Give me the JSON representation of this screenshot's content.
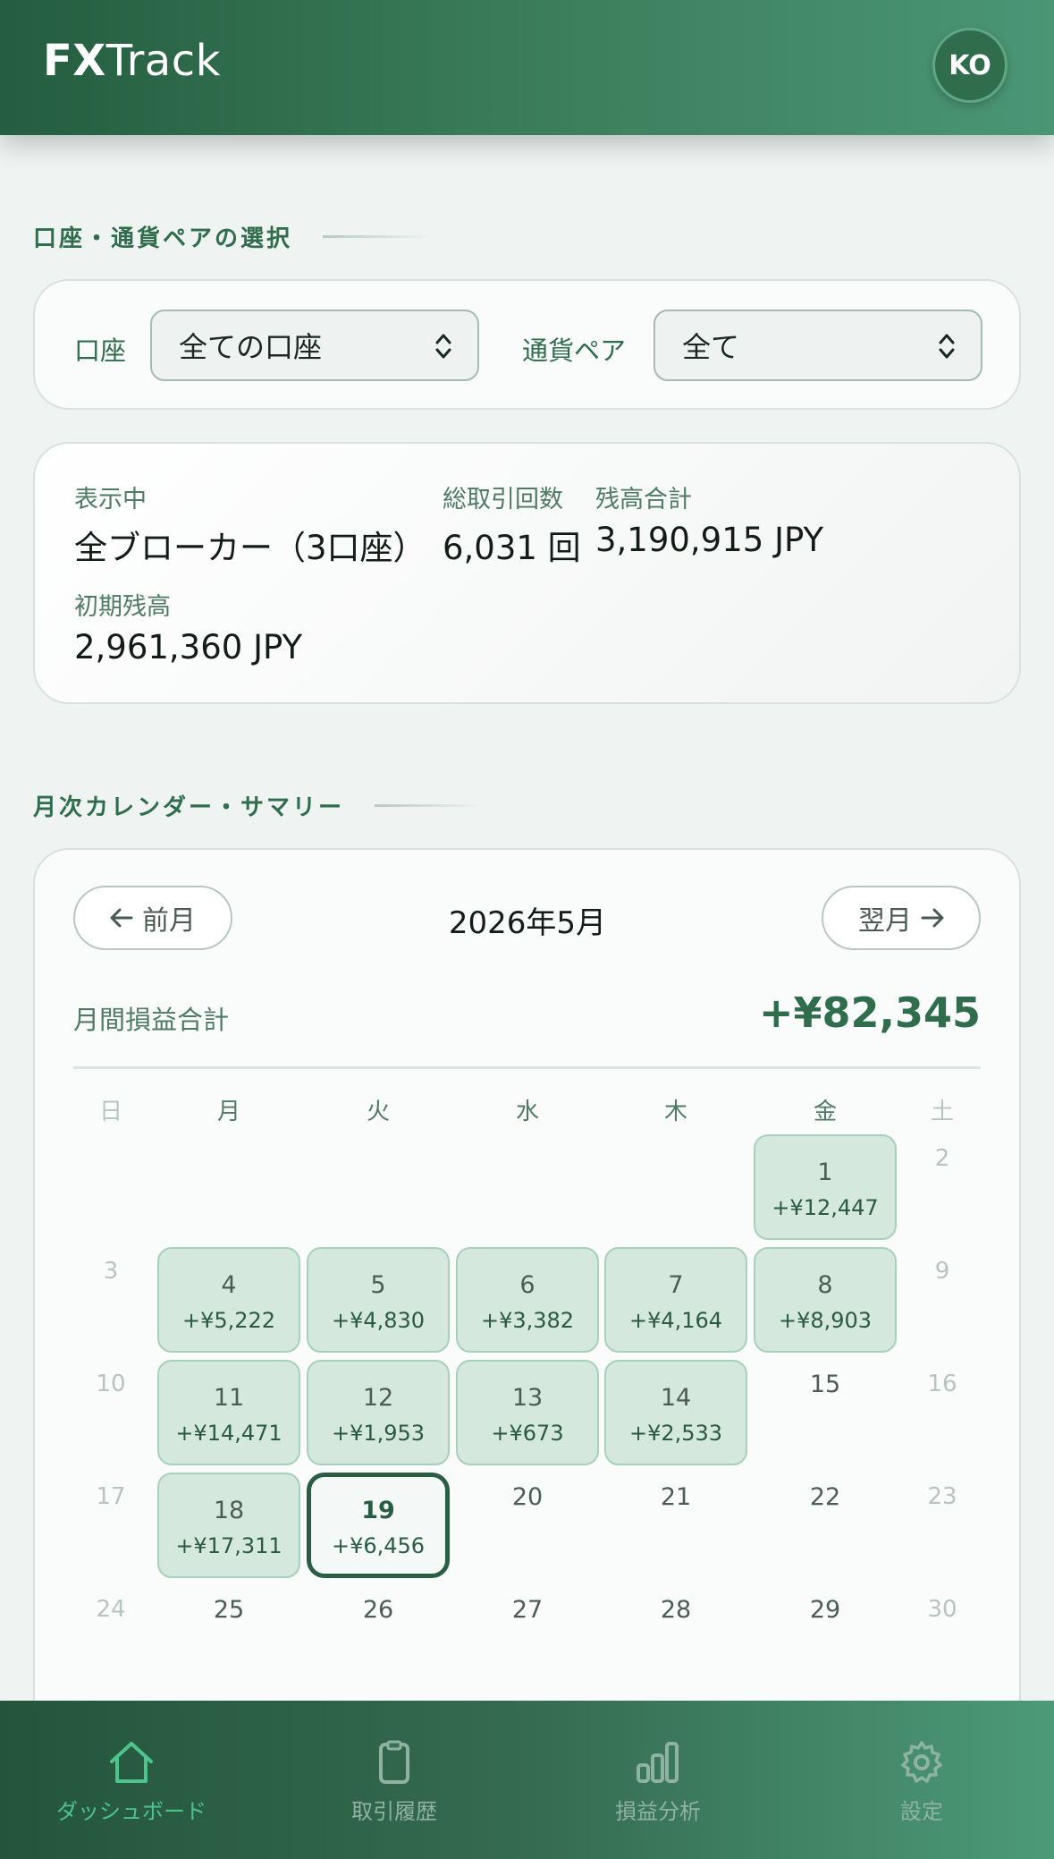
{
  "header": {
    "brand_bold": "FX",
    "brand_rest": "Track",
    "avatar": "KO"
  },
  "selection": {
    "title": "口座・通貨ペアの選択",
    "account_label": "口座",
    "account_value": "全ての口座",
    "pair_label": "通貨ペア",
    "pair_value": "全て"
  },
  "summary": {
    "showing_label": "表示中",
    "showing_value": "全ブローカー（3口座）",
    "trades_label": "総取引回数",
    "trades_value": "6,031 回",
    "balance_label": "残高合計",
    "balance_value": "3,190,915 JPY",
    "initial_label": "初期残高",
    "initial_value": "2,961,360 JPY"
  },
  "calendar": {
    "title": "月次カレンダー・サマリー",
    "prev_label": "前月",
    "next_label": "翌月",
    "month": "2026年5月",
    "monthly_pl_label": "月間損益合計",
    "monthly_pl_value": "+¥82,345",
    "weekdays": [
      "日",
      "月",
      "火",
      "水",
      "木",
      "金",
      "土"
    ],
    "today": "19",
    "weeks": [
      [
        {
          "d": ""
        },
        {
          "d": ""
        },
        {
          "d": ""
        },
        {
          "d": ""
        },
        {
          "d": ""
        },
        {
          "d": "1",
          "pl": "+¥12,447"
        },
        {
          "d": "2"
        }
      ],
      [
        {
          "d": "3"
        },
        {
          "d": "4",
          "pl": "+¥5,222"
        },
        {
          "d": "5",
          "pl": "+¥4,830"
        },
        {
          "d": "6",
          "pl": "+¥3,382"
        },
        {
          "d": "7",
          "pl": "+¥4,164"
        },
        {
          "d": "8",
          "pl": "+¥8,903"
        },
        {
          "d": "9"
        }
      ],
      [
        {
          "d": "10"
        },
        {
          "d": "11",
          "pl": "+¥14,471"
        },
        {
          "d": "12",
          "pl": "+¥1,953"
        },
        {
          "d": "13",
          "pl": "+¥673"
        },
        {
          "d": "14",
          "pl": "+¥2,533"
        },
        {
          "d": "15"
        },
        {
          "d": "16"
        }
      ],
      [
        {
          "d": "17"
        },
        {
          "d": "18",
          "pl": "+¥17,311"
        },
        {
          "d": "19",
          "pl": "+¥6,456"
        },
        {
          "d": "20"
        },
        {
          "d": "21"
        },
        {
          "d": "22"
        },
        {
          "d": "23"
        }
      ],
      [
        {
          "d": "24"
        },
        {
          "d": "25"
        },
        {
          "d": "26"
        },
        {
          "d": "27"
        },
        {
          "d": "28"
        },
        {
          "d": "29"
        },
        {
          "d": "30"
        }
      ]
    ]
  },
  "nav": {
    "items": [
      {
        "label": "ダッシュボード",
        "icon": "home-icon",
        "active": true
      },
      {
        "label": "取引履歴",
        "icon": "clipboard-icon",
        "active": false
      },
      {
        "label": "損益分析",
        "icon": "bar-chart-icon",
        "active": false
      },
      {
        "label": "設定",
        "icon": "gear-icon",
        "active": false
      }
    ]
  },
  "colors": {
    "brand": "#2f6d4d",
    "profit_bg": "#d5e8de",
    "active_tab": "#4ec48d"
  }
}
